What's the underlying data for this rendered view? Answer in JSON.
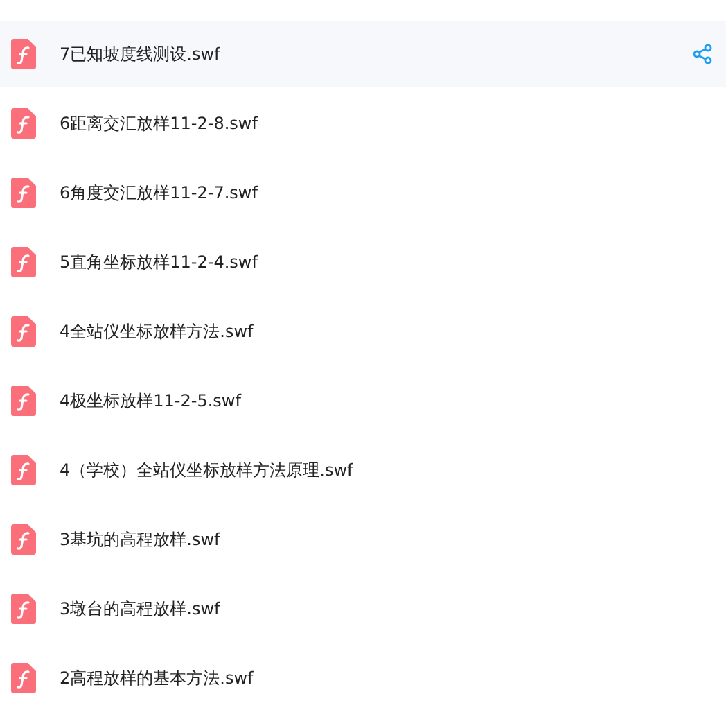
{
  "files": [
    {
      "name": "7已知坡度线测设.swf",
      "selected": true
    },
    {
      "name": "6距离交汇放样11-2-8.swf",
      "selected": false
    },
    {
      "name": "6角度交汇放样11-2-7.swf",
      "selected": false
    },
    {
      "name": "5直角坐标放样11-2-4.swf",
      "selected": false
    },
    {
      "name": "4全站仪坐标放样方法.swf",
      "selected": false
    },
    {
      "name": "4极坐标放样11-2-5.swf",
      "selected": false
    },
    {
      "name": "4（学校）全站仪坐标放样方法原理.swf",
      "selected": false
    },
    {
      "name": "3基坑的高程放样.swf",
      "selected": false
    },
    {
      "name": "3墩台的高程放样.swf",
      "selected": false
    },
    {
      "name": "2高程放样的基本方法.swf",
      "selected": false
    }
  ]
}
